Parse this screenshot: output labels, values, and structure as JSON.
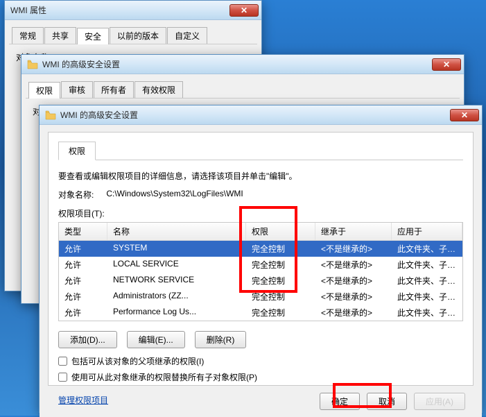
{
  "back1": {
    "title": "WMI 属性",
    "tabs": [
      "常规",
      "共享",
      "安全",
      "以前的版本",
      "自定义"
    ],
    "active_tab_index": 2,
    "object_label": "对象名称:"
  },
  "back2": {
    "title": "WMI 的高级安全设置",
    "tabs": [
      "权限",
      "审核",
      "所有者",
      "有效权限"
    ],
    "active_tab_index": 0,
    "object_label": "对象名称:"
  },
  "front": {
    "title": "WMI 的高级安全设置",
    "tab_label": "权限",
    "intro": "要查看或编辑权限项目的详细信息，请选择该项目并单击\"编辑\"。",
    "object_label": "对象名称:",
    "object_path": "C:\\Windows\\System32\\LogFiles\\WMI",
    "list_label": "权限项目(T):",
    "columns": {
      "c1": "类型",
      "c2": "名称",
      "c3": "权限",
      "c4": "继承于",
      "c5": "应用于"
    },
    "rows": [
      {
        "type": "允许",
        "name": "SYSTEM",
        "perm": "完全控制",
        "inherit": "<不是继承的>",
        "apply": "此文件夹、子文件夹..."
      },
      {
        "type": "允许",
        "name": "LOCAL SERVICE",
        "perm": "完全控制",
        "inherit": "<不是继承的>",
        "apply": "此文件夹、子文件夹..."
      },
      {
        "type": "允许",
        "name": "NETWORK SERVICE",
        "perm": "完全控制",
        "inherit": "<不是继承的>",
        "apply": "此文件夹、子文件夹..."
      },
      {
        "type": "允许",
        "name": "Administrators (ZZ...",
        "perm": "完全控制",
        "inherit": "<不是继承的>",
        "apply": "此文件夹、子文件夹..."
      },
      {
        "type": "允许",
        "name": "Performance Log Us...",
        "perm": "完全控制",
        "inherit": "<不是继承的>",
        "apply": "此文件夹、子文件夹..."
      }
    ],
    "selected_row_index": 0,
    "buttons": {
      "add": "添加(D)...",
      "edit": "编辑(E)...",
      "remove": "删除(R)"
    },
    "checks": {
      "include_inherit": "包括可从该对象的父项继承的权限(I)",
      "replace_children": "使用可从此对象继承的权限替换所有子对象权限(P)"
    },
    "link": "管理权限项目",
    "bottom": {
      "ok": "确定",
      "cancel": "取消",
      "apply": "应用(A)"
    }
  },
  "annotation": {
    "red_highlight_column": "权限",
    "red_highlight_button": "确定"
  }
}
